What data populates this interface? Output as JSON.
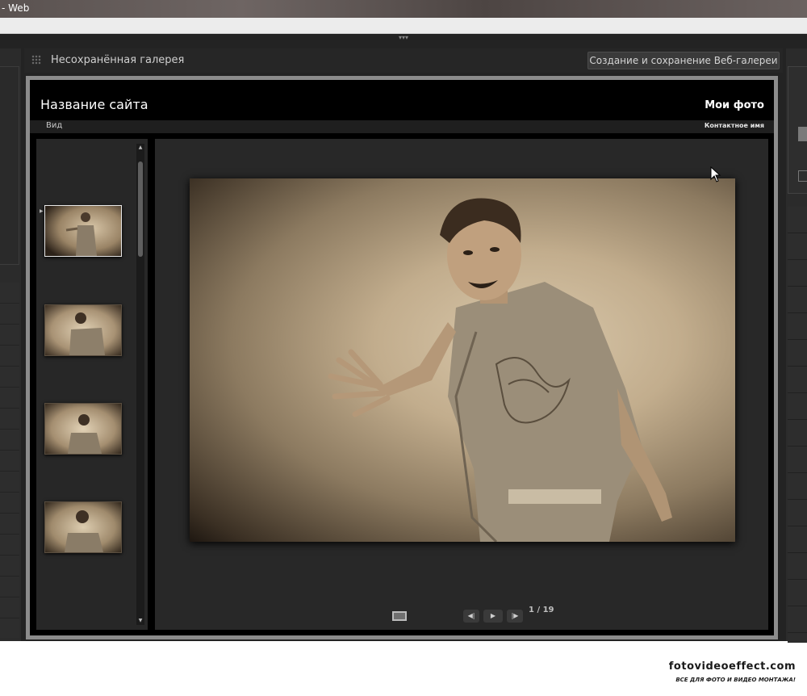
{
  "window": {
    "title_fragment": "- Web"
  },
  "header": {
    "gallery_title": "Несохранённая галерея",
    "save_button_label": "Создание и сохранение Веб-галереи"
  },
  "site": {
    "site_name": "Название сайта",
    "collection_title": "Мои фото",
    "nav_view": "Вид",
    "nav_contact": "Контактное имя"
  },
  "thumbnails": {
    "count_visible": 4,
    "selected_index": 0
  },
  "controls": {
    "counter": "1 / 19",
    "icons": [
      "screen-icon",
      "previous-icon",
      "play-icon",
      "next-icon"
    ]
  },
  "watermark": {
    "site": "fotovideoeffect.com",
    "tagline": "ВСЕ ДЛЯ ФОТО И ВИДЕО МОНТАЖА!"
  },
  "colors": {
    "app_background": "#232323",
    "site_background": "#000000",
    "sepia_light": "#d9c8ab",
    "sepia_dark": "#1e1711"
  }
}
